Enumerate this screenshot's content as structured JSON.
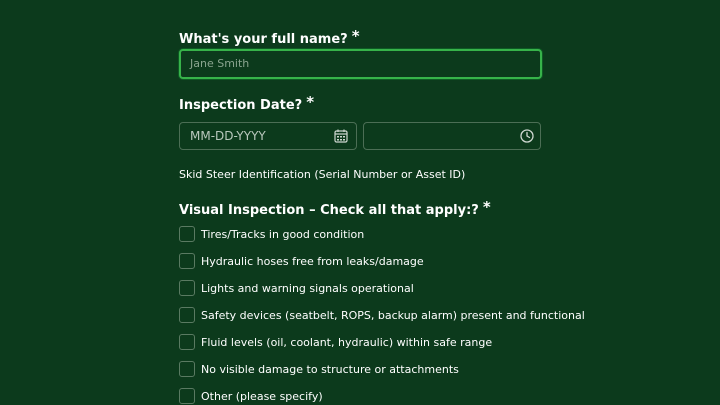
{
  "name_question": {
    "label": "What's your full name?",
    "required_mark": "*",
    "placeholder": "Jane Smith"
  },
  "date_question": {
    "label": "Inspection Date?",
    "required_mark": "*",
    "date_placeholder": "MM-DD-YYYY",
    "date_icon": "calendar-icon",
    "time_icon": "clock-icon"
  },
  "skid_steer_label": "Skid Steer Identification (Serial Number or Asset ID)",
  "visual_inspection": {
    "label": "Visual Inspection – Check all that apply:?",
    "required_mark": "*",
    "options": [
      "Tires/Tracks in good condition",
      "Hydraulic hoses free from leaks/damage",
      "Lights and warning signals operational",
      "Safety devices (seatbelt, ROPS, backup alarm) present and functional",
      "Fluid levels (oil, coolant, hydraulic) within safe range",
      "No visible damage to structure or attachments",
      "Other (please specify)"
    ]
  },
  "colors": {
    "background": "#0c3a1c",
    "focus_border": "#37b34a",
    "input_border": "#4c6e55"
  }
}
